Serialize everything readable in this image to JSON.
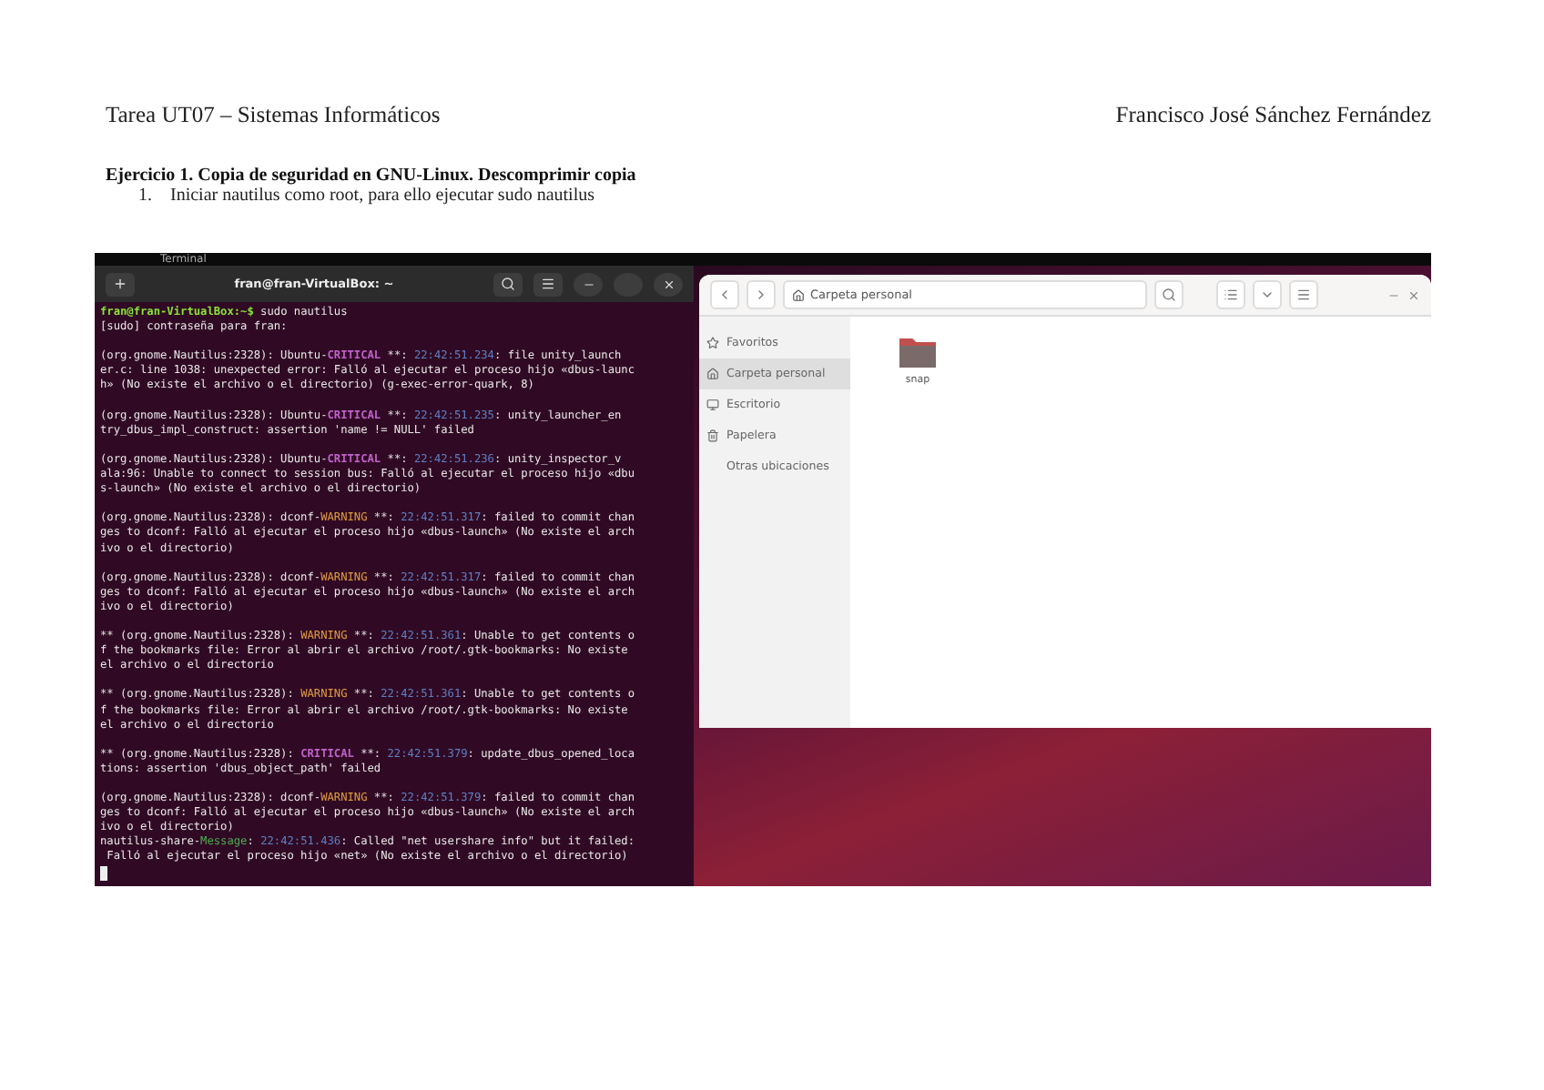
{
  "header": {
    "left": "Tarea UT07 – Sistemas Informáticos",
    "right": "Francisco José Sánchez Fernández"
  },
  "heading": "Ejercicio 1. Copia de seguridad en GNU-Linux. Descomprimir copia",
  "steps": [
    {
      "number": "1.",
      "text": "Iniciar nautilus como root, para ello ejecutar sudo nautilus"
    }
  ],
  "screenshot": {
    "top_bar": {
      "label": "Terminal"
    },
    "terminal": {
      "title": "fran@fran-VirtualBox: ~",
      "blocks": [
        {
          "lines": [
            [
              {
                "kind": "prompt",
                "text": "fran@fran-VirtualBox:~$"
              },
              {
                "kind": "plain",
                "text": " sudo nautilus"
              }
            ],
            [
              {
                "kind": "plain",
                "text": "[sudo] contraseña para fran:"
              }
            ]
          ]
        },
        {
          "lines": [
            [
              {
                "kind": "plain",
                "text": "(org.gnome.Nautilus:2328): Ubuntu-"
              },
              {
                "kind": "critical",
                "text": "CRITICAL"
              },
              {
                "kind": "plain",
                "text": " **: "
              },
              {
                "kind": "time",
                "text": "22:42:51.234"
              },
              {
                "kind": "plain",
                "text": ": file unity_launch"
              }
            ],
            [
              {
                "kind": "plain",
                "text": "er.c: line 1038: unexpected error: Falló al ejecutar el proceso hijo «dbus-launc"
              }
            ],
            [
              {
                "kind": "plain",
                "text": "h» (No existe el archivo o el directorio) (g-exec-error-quark, 8)"
              }
            ]
          ]
        },
        {
          "lines": [
            [
              {
                "kind": "plain",
                "text": "(org.gnome.Nautilus:2328): Ubuntu-"
              },
              {
                "kind": "critical",
                "text": "CRITICAL"
              },
              {
                "kind": "plain",
                "text": " **: "
              },
              {
                "kind": "time",
                "text": "22:42:51.235"
              },
              {
                "kind": "plain",
                "text": ": unity_launcher_en"
              }
            ],
            [
              {
                "kind": "plain",
                "text": "try_dbus_impl_construct: assertion 'name != NULL' failed"
              }
            ]
          ]
        },
        {
          "lines": [
            [
              {
                "kind": "plain",
                "text": "(org.gnome.Nautilus:2328): Ubuntu-"
              },
              {
                "kind": "critical",
                "text": "CRITICAL"
              },
              {
                "kind": "plain",
                "text": " **: "
              },
              {
                "kind": "time",
                "text": "22:42:51.236"
              },
              {
                "kind": "plain",
                "text": ": unity_inspector_v"
              }
            ],
            [
              {
                "kind": "plain",
                "text": "ala:96: Unable to connect to session bus: Falló al ejecutar el proceso hijo «dbu"
              }
            ],
            [
              {
                "kind": "plain",
                "text": "s-launch» (No existe el archivo o el directorio)"
              }
            ]
          ]
        },
        {
          "lines": [
            [
              {
                "kind": "plain",
                "text": "(org.gnome.Nautilus:2328): dconf-"
              },
              {
                "kind": "warning",
                "text": "WARNING"
              },
              {
                "kind": "plain",
                "text": " **: "
              },
              {
                "kind": "time",
                "text": "22:42:51.317"
              },
              {
                "kind": "plain",
                "text": ": failed to commit chan"
              }
            ],
            [
              {
                "kind": "plain",
                "text": "ges to dconf: Falló al ejecutar el proceso hijo «dbus-launch» (No existe el arch"
              }
            ],
            [
              {
                "kind": "plain",
                "text": "ivo o el directorio)"
              }
            ]
          ]
        },
        {
          "lines": [
            [
              {
                "kind": "plain",
                "text": "(org.gnome.Nautilus:2328): dconf-"
              },
              {
                "kind": "warning",
                "text": "WARNING"
              },
              {
                "kind": "plain",
                "text": " **: "
              },
              {
                "kind": "time",
                "text": "22:42:51.317"
              },
              {
                "kind": "plain",
                "text": ": failed to commit chan"
              }
            ],
            [
              {
                "kind": "plain",
                "text": "ges to dconf: Falló al ejecutar el proceso hijo «dbus-launch» (No existe el arch"
              }
            ],
            [
              {
                "kind": "plain",
                "text": "ivo o el directorio)"
              }
            ]
          ]
        },
        {
          "lines": [
            [
              {
                "kind": "plain",
                "text": "** (org.gnome.Nautilus:2328): "
              },
              {
                "kind": "warning",
                "text": "WARNING"
              },
              {
                "kind": "plain",
                "text": " **: "
              },
              {
                "kind": "time",
                "text": "22:42:51.361"
              },
              {
                "kind": "plain",
                "text": ": Unable to get contents o"
              }
            ],
            [
              {
                "kind": "plain",
                "text": "f the bookmarks file: Error al abrir el archivo /root/.gtk-bookmarks: No existe"
              }
            ],
            [
              {
                "kind": "plain",
                "text": "el archivo o el directorio"
              }
            ]
          ]
        },
        {
          "lines": [
            [
              {
                "kind": "plain",
                "text": "** (org.gnome.Nautilus:2328): "
              },
              {
                "kind": "warning",
                "text": "WARNING"
              },
              {
                "kind": "plain",
                "text": " **: "
              },
              {
                "kind": "time",
                "text": "22:42:51.361"
              },
              {
                "kind": "plain",
                "text": ": Unable to get contents o"
              }
            ],
            [
              {
                "kind": "plain",
                "text": "f the bookmarks file: Error al abrir el archivo /root/.gtk-bookmarks: No existe"
              }
            ],
            [
              {
                "kind": "plain",
                "text": "el archivo o el directorio"
              }
            ]
          ]
        },
        {
          "lines": [
            [
              {
                "kind": "plain",
                "text": "** (org.gnome.Nautilus:2328): "
              },
              {
                "kind": "critical",
                "text": "CRITICAL"
              },
              {
                "kind": "plain",
                "text": " **: "
              },
              {
                "kind": "time",
                "text": "22:42:51.379"
              },
              {
                "kind": "plain",
                "text": ": update_dbus_opened_loca"
              }
            ],
            [
              {
                "kind": "plain",
                "text": "tions: assertion 'dbus_object_path' failed"
              }
            ]
          ]
        },
        {
          "lines": [
            [
              {
                "kind": "plain",
                "text": "(org.gnome.Nautilus:2328): dconf-"
              },
              {
                "kind": "warning",
                "text": "WARNING"
              },
              {
                "kind": "plain",
                "text": " **: "
              },
              {
                "kind": "time",
                "text": "22:42:51.379"
              },
              {
                "kind": "plain",
                "text": ": failed to commit chan"
              }
            ],
            [
              {
                "kind": "plain",
                "text": "ges to dconf: Falló al ejecutar el proceso hijo «dbus-launch» (No existe el arch"
              }
            ],
            [
              {
                "kind": "plain",
                "text": "ivo o el directorio)"
              }
            ],
            [
              {
                "kind": "plain",
                "text": "nautilus-share-"
              },
              {
                "kind": "message",
                "text": "Message"
              },
              {
                "kind": "plain",
                "text": ": "
              },
              {
                "kind": "time",
                "text": "22:42:51.436"
              },
              {
                "kind": "plain",
                "text": ": Called \"net usershare info\" but it failed:"
              }
            ],
            [
              {
                "kind": "plain",
                "text": " Falló al ejecutar el proceso hijo «net» (No existe el archivo o el directorio)"
              }
            ]
          ]
        }
      ]
    },
    "files": {
      "path": "Carpeta personal",
      "sidebar": [
        {
          "label": "Favoritos",
          "selected": false
        },
        {
          "label": "Carpeta personal",
          "selected": true
        },
        {
          "label": "Escritorio",
          "selected": false
        },
        {
          "label": "Papelera",
          "selected": false
        },
        {
          "label": "Otras ubicaciones",
          "selected": false
        }
      ],
      "items": [
        {
          "name": "snap"
        }
      ]
    }
  }
}
